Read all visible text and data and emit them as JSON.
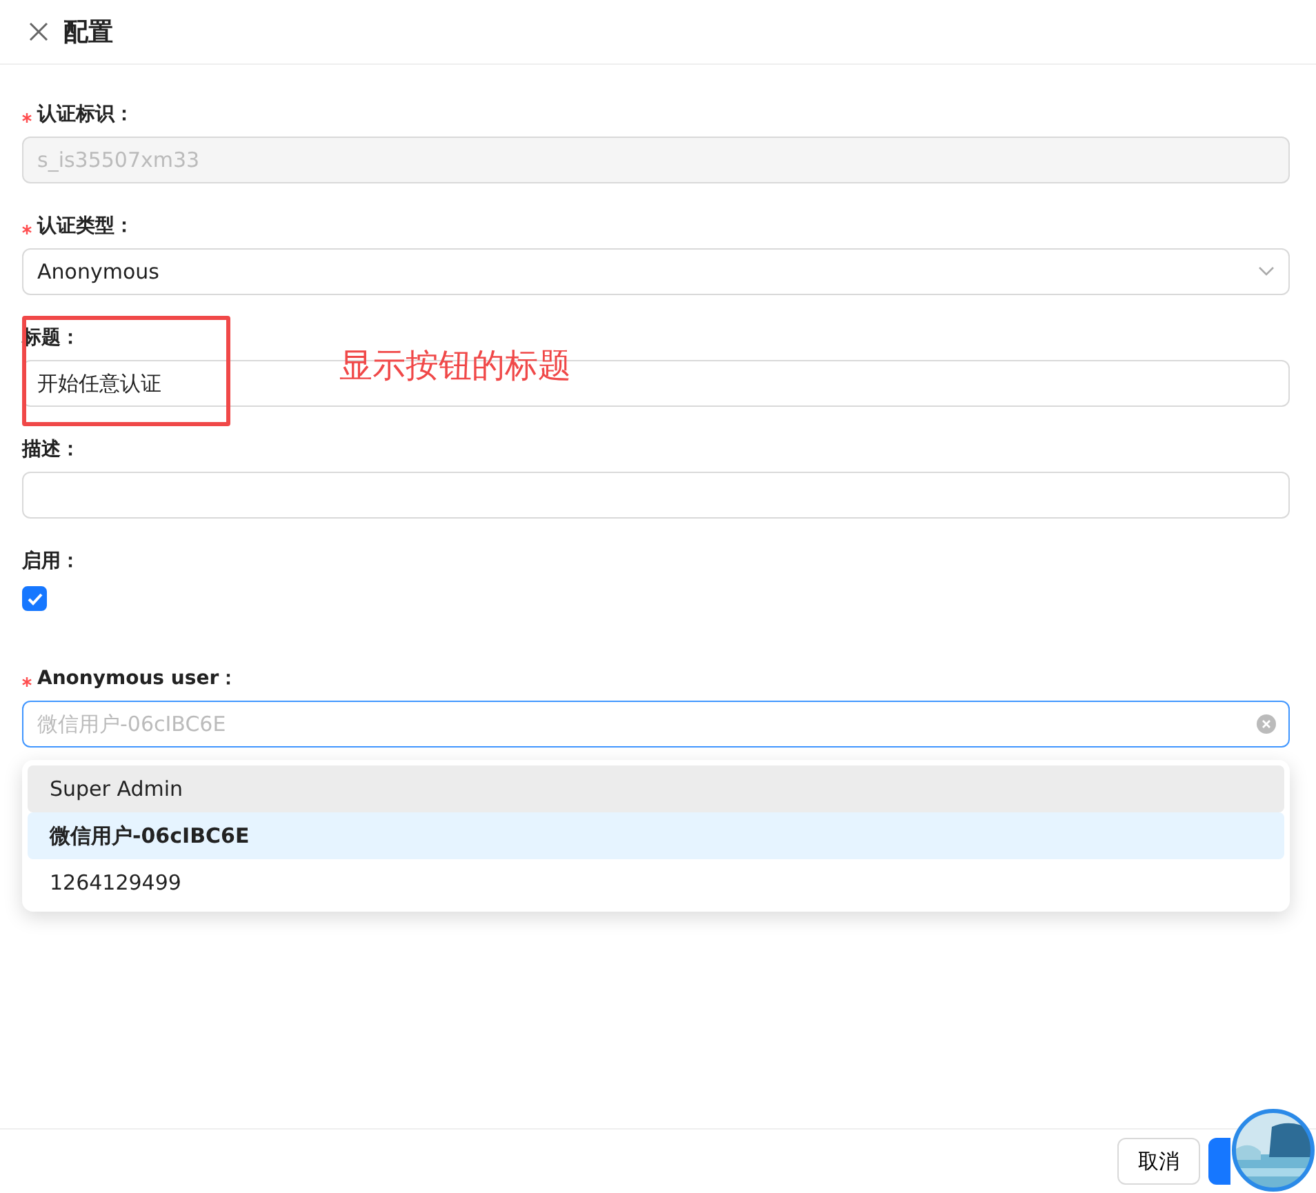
{
  "drawer": {
    "title": "配置"
  },
  "fields": [
    {
      "kind": "input",
      "label": "认证标识：",
      "required": true,
      "value": "s_is35507xm33",
      "disabled": true
    },
    {
      "kind": "select",
      "label": "认证类型：",
      "required": true,
      "value": "Anonymous"
    },
    {
      "kind": "input",
      "label": "标题：",
      "required": false,
      "value": "开始任意认证",
      "annotation": "显示按钮的标题"
    },
    {
      "kind": "input",
      "label": "描述：",
      "required": false
    },
    {
      "kind": "checkbox",
      "label": "启用：",
      "required": false,
      "checked": true
    },
    {
      "kind": "combobox",
      "label": "Anonymous user：",
      "required": true,
      "placeholder": "微信用户-06cIBC6E",
      "focused": true
    }
  ],
  "dropdown": [
    {
      "label": "Super Admin",
      "selected": false,
      "hovered": true
    },
    {
      "label": "微信用户-06cIBC6E",
      "selected": true,
      "hovered": false
    },
    {
      "label": "1264129499",
      "selected": false,
      "hovered": false
    }
  ],
  "footer": {
    "cancel": "取消"
  }
}
